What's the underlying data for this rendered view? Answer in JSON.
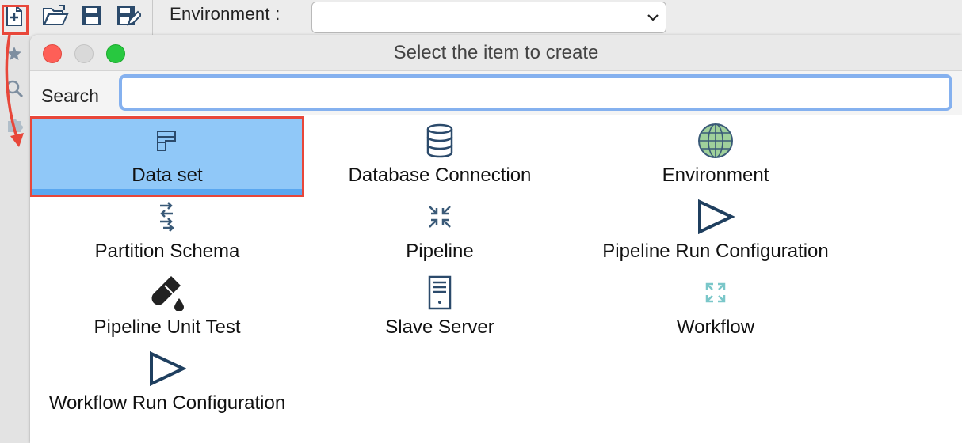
{
  "toolbar": {
    "environment_label": "Environment :",
    "environment_value": "",
    "icons": [
      "new-file-icon",
      "open-folder-icon",
      "save-icon",
      "save-as-icon",
      "chevron-down-icon"
    ]
  },
  "dialog": {
    "title": "Select the item to create",
    "search_label": "Search",
    "search_value": "",
    "items": [
      {
        "label": "Data set",
        "icon": "dataset-icon",
        "selected": true
      },
      {
        "label": "Database Connection",
        "icon": "database-icon"
      },
      {
        "label": "Environment",
        "icon": "globe-icon"
      },
      {
        "label": "Partition Schema",
        "icon": "partition-icon"
      },
      {
        "label": "Pipeline",
        "icon": "pipeline-icon"
      },
      {
        "label": "Pipeline Run Configuration",
        "icon": "play-triangle-icon"
      },
      {
        "label": "Pipeline Unit Test",
        "icon": "test-tube-icon"
      },
      {
        "label": "Slave Server",
        "icon": "server-icon"
      },
      {
        "label": "Workflow",
        "icon": "workflow-icon"
      },
      {
        "label": "Workflow Run Configuration",
        "icon": "play-triangle-icon"
      }
    ]
  },
  "colors": {
    "highlight_outline": "#e8473a",
    "selection": "#90c8f8",
    "icon_dark": "#2b4a6b",
    "search_focus": "#85b1ef"
  }
}
